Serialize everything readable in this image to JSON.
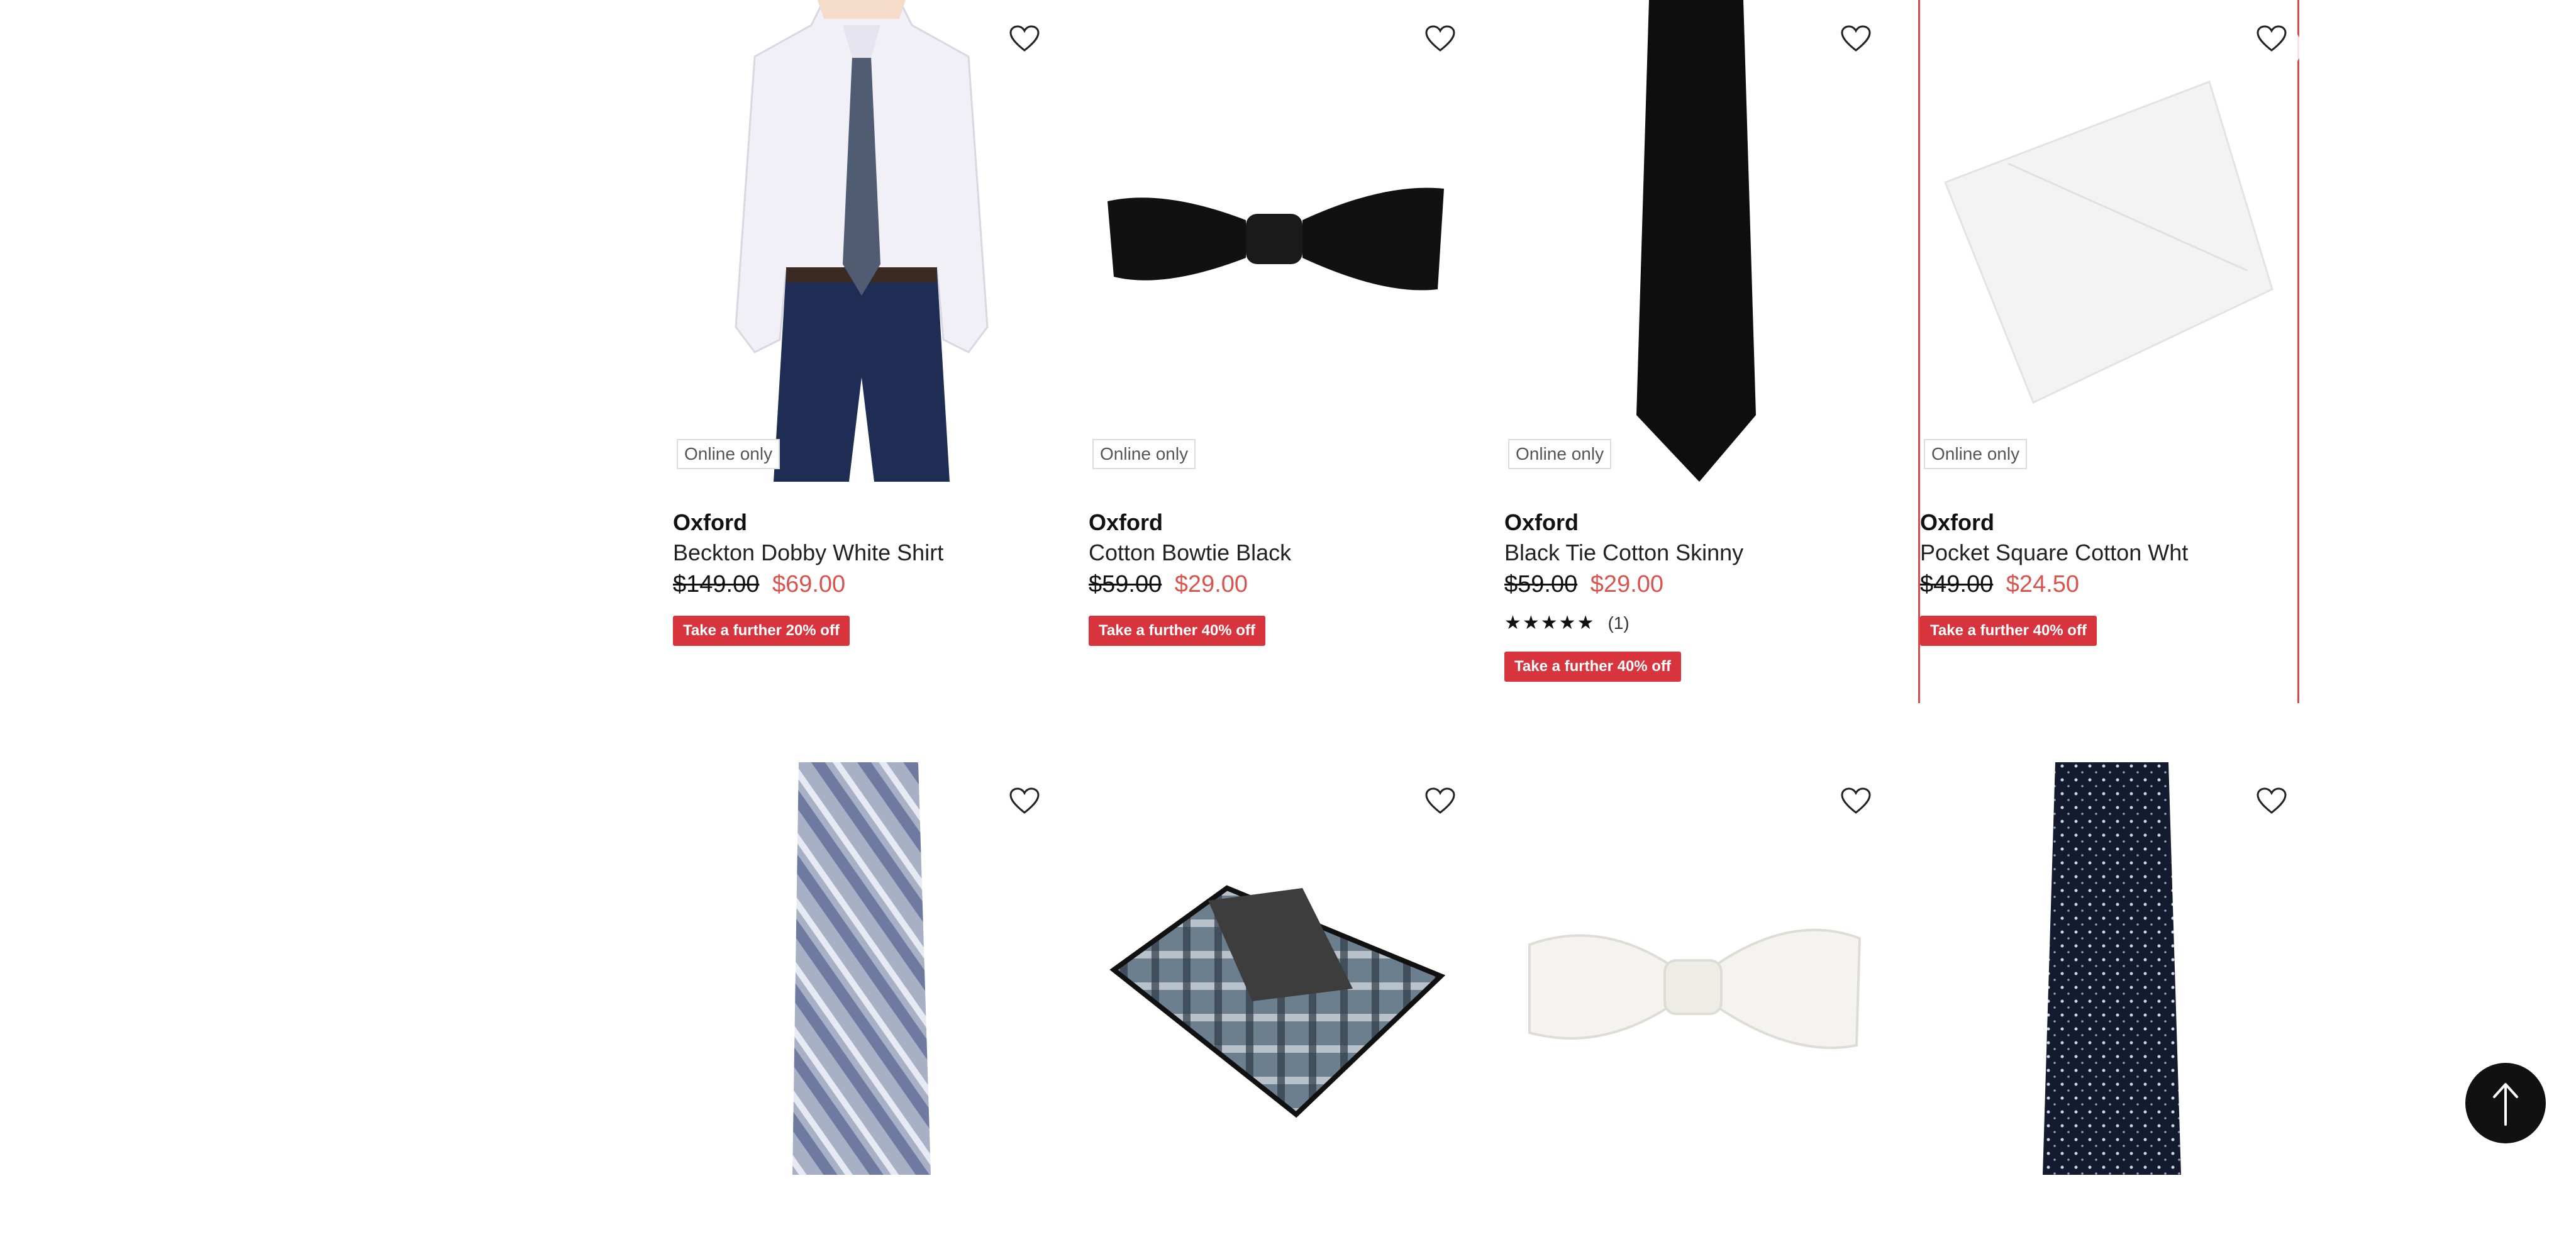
{
  "products": [
    {
      "brand": "Oxford",
      "name": "Beckton Dobby White Shirt",
      "was": "$149.00",
      "now": "$69.00",
      "badge": "Online only",
      "promo": "Take a further 20% off"
    },
    {
      "brand": "Oxford",
      "name": "Cotton Bowtie Black",
      "was": "$59.00",
      "now": "$29.00",
      "badge": "Online only",
      "promo": "Take a further 40% off"
    },
    {
      "brand": "Oxford",
      "name": "Black Tie Cotton Skinny",
      "was": "$59.00",
      "now": "$29.00",
      "badge": "Online only",
      "promo": "Take a further 40% off",
      "rating_count": "(1)",
      "rating_stars": "★★★★★"
    },
    {
      "brand": "Oxford",
      "name": "Pocket Square Cotton Wht",
      "was": "$49.00",
      "now": "$24.50",
      "badge": "Online only",
      "promo": "Take a further 40% off"
    }
  ],
  "icons": {
    "wishlist": "heart-icon",
    "back_to_top": "arrow-up-icon"
  },
  "colors": {
    "sale": "#d9534f",
    "promo_bg": "#d8343d",
    "selection": "#d9484d"
  }
}
